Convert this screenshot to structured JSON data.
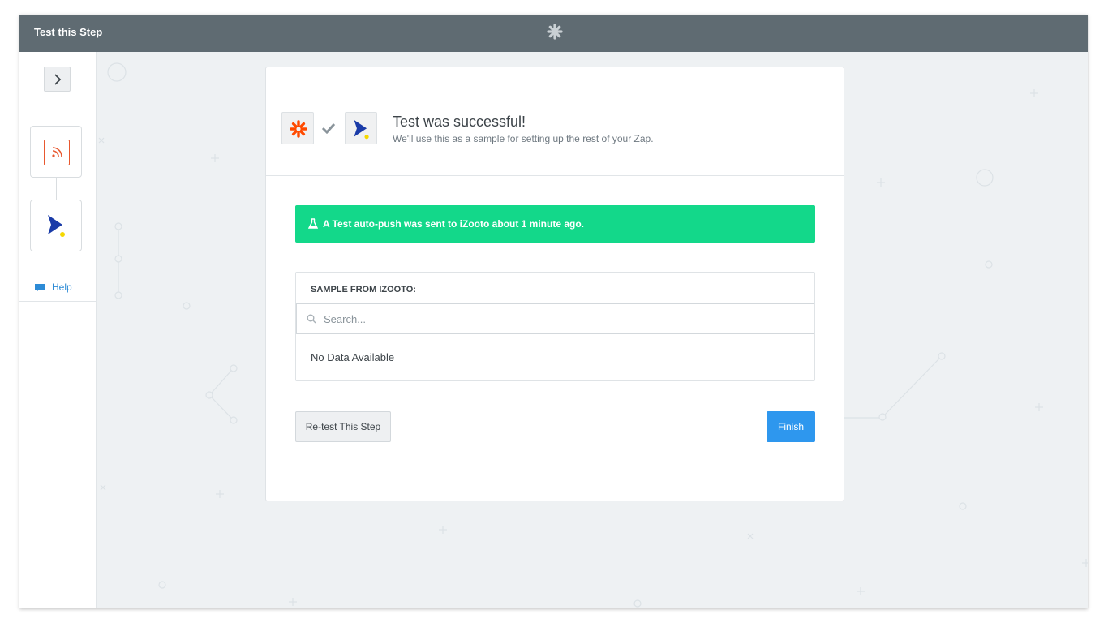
{
  "window": {
    "title": "Test this Step",
    "logo_icon": "zapier-asterisk-icon"
  },
  "sidebar": {
    "collapse_icon": "chevron-right-icon",
    "steps": [
      {
        "app": "RSS",
        "icon": "rss-icon",
        "color": "#e8582f"
      },
      {
        "app": "iZooto",
        "icon": "izooto-chevron-icon",
        "color": "#1a3ba8"
      }
    ],
    "help_label": "Help",
    "help_icon": "chat-bubble-icon"
  },
  "header": {
    "title": "Test was successful!",
    "subtitle": "We'll use this as a sample for setting up the rest of your Zap."
  },
  "alert": {
    "text": "A Test auto-push was sent to iZooto about 1 minute ago.",
    "icon": "flask-icon",
    "color": "#13d88a"
  },
  "sample": {
    "title": "SAMPLE FROM IZOOTO:",
    "search_placeholder": "Search...",
    "search_value": "",
    "empty_text": "No Data Available"
  },
  "buttons": {
    "retest_label": "Re-test This Step",
    "finish_label": "Finish",
    "finish_color": "#2e97ee"
  },
  "colors": {
    "titlebar": "#5f6b72",
    "zapier_orange": "#ff4a00",
    "izooto_blue": "#1a3ba8",
    "izooto_yellow": "#f5d800"
  }
}
